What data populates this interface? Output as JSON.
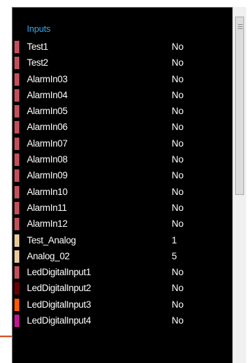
{
  "section": {
    "title": "Inputs"
  },
  "colors": {
    "panel_bg": "#000000",
    "title": "#3aa7e6",
    "text": "#ffffff",
    "pointer": "#cc3300"
  },
  "rows": [
    {
      "name": "Test1",
      "value": "No",
      "color": "#c0505a"
    },
    {
      "name": "Test2",
      "value": "No",
      "color": "#c0505a"
    },
    {
      "name": "AlarmIn03",
      "value": "No",
      "color": "#c0505a"
    },
    {
      "name": "AlarmIn04",
      "value": "No",
      "color": "#c0505a"
    },
    {
      "name": "AlarmIn05",
      "value": "No",
      "color": "#c0505a"
    },
    {
      "name": "AlarmIn06",
      "value": "No",
      "color": "#c0505a"
    },
    {
      "name": "AlarmIn07",
      "value": "No",
      "color": "#c0505a"
    },
    {
      "name": "AlarmIn08",
      "value": "No",
      "color": "#c0505a"
    },
    {
      "name": "AlarmIn09",
      "value": "No",
      "color": "#c0505a"
    },
    {
      "name": "AlarmIn10",
      "value": "No",
      "color": "#c0505a"
    },
    {
      "name": "AlarmIn11",
      "value": "No",
      "color": "#c0505a"
    },
    {
      "name": "AlarmIn12",
      "value": "No",
      "color": "#c0505a"
    },
    {
      "name": "Test_Analog",
      "value": "1",
      "color": "#e8c99a"
    },
    {
      "name": "Analog_02",
      "value": "5",
      "color": "#e8c99a"
    },
    {
      "name": "LedDigitalInput1",
      "value": "No",
      "color": "#c0505a"
    },
    {
      "name": "LedDigitalInput2",
      "value": "No",
      "color": "#6a0000"
    },
    {
      "name": "LedDigitalInput3",
      "value": "No",
      "color": "#ff5a00"
    },
    {
      "name": "LedDigitalInput4",
      "value": "No",
      "color": "#c01890"
    }
  ]
}
